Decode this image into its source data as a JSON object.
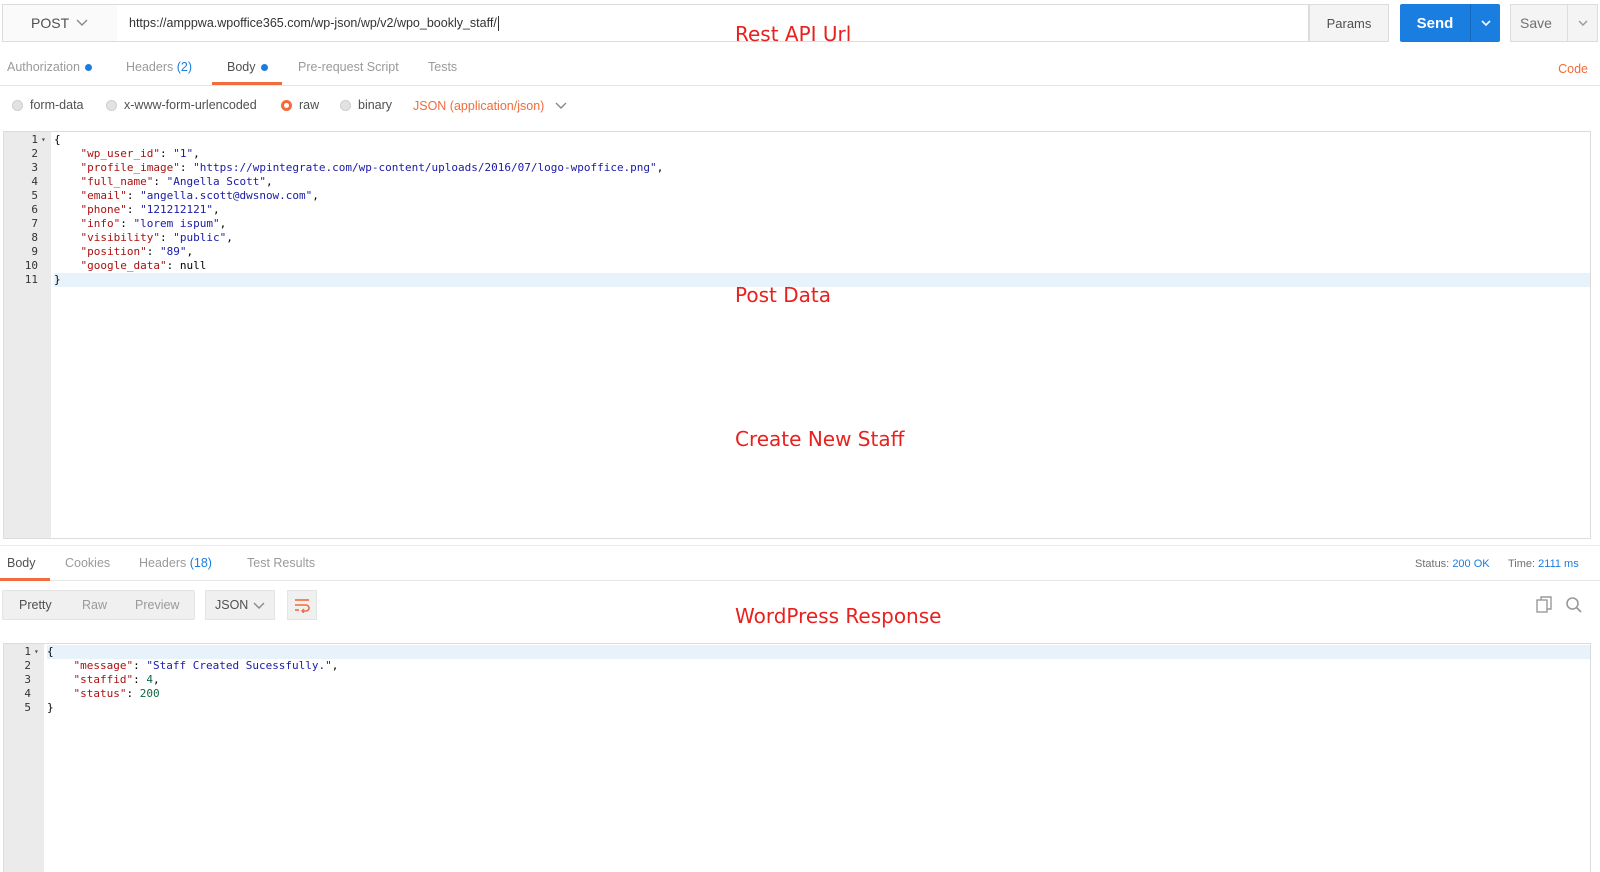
{
  "request": {
    "method": "POST",
    "url": "https://amppwa.wpoffice365.com/wp-json/wp/v2/wpo_bookly_staff/",
    "params_label": "Params",
    "send_label": "Send",
    "save_label": "Save"
  },
  "request_tabs": [
    {
      "label": "Authorization",
      "dot": true
    },
    {
      "label": "Headers",
      "count": "(2)"
    },
    {
      "label": "Body",
      "dot": true,
      "active": true
    },
    {
      "label": "Pre-request Script"
    },
    {
      "label": "Tests"
    }
  ],
  "code_link": "Code",
  "body_types": [
    {
      "label": "form-data",
      "selected": false
    },
    {
      "label": "x-www-form-urlencoded",
      "selected": false
    },
    {
      "label": "raw",
      "selected": true
    },
    {
      "label": "binary",
      "selected": false
    }
  ],
  "content_type": "JSON (application/json)",
  "request_body_lines": [
    "{",
    "    \"wp_user_id\": \"1\",",
    "    \"profile_image\": \"https://wpintegrate.com/wp-content/uploads/2016/07/logo-wpoffice.png\",",
    "    \"full_name\": \"Angella Scott\",",
    "    \"email\": \"angella.scott@dwsnow.com\",",
    "    \"phone\": \"121212121\",",
    "    \"info\": \"lorem ispum\",",
    "    \"visibility\": \"public\",",
    "    \"position\": \"89\",",
    "    \"google_data\": null",
    "}"
  ],
  "response_tabs": [
    {
      "label": "Body",
      "active": true
    },
    {
      "label": "Cookies"
    },
    {
      "label": "Headers",
      "count": "(18)"
    },
    {
      "label": "Test Results"
    }
  ],
  "response_status": {
    "status_label": "Status:",
    "status_value": "200 OK",
    "time_label": "Time:",
    "time_value": "2111 ms"
  },
  "response_views": [
    "Pretty",
    "Raw",
    "Preview"
  ],
  "response_active_view": "Pretty",
  "response_format": "JSON",
  "response_body_lines": [
    "{",
    "    \"message\": \"Staff Created Sucessfully.\",",
    "    \"staffid\": 4,",
    "    \"status\": 200",
    "}"
  ],
  "annotations": {
    "url": "Rest API Url",
    "post_data": "Post Data",
    "create_staff": "Create New Staff",
    "response": "WordPress Response"
  },
  "colors": {
    "accent": "#f26b3a",
    "primary": "#1a7de0",
    "annotation": "#e8201e"
  }
}
